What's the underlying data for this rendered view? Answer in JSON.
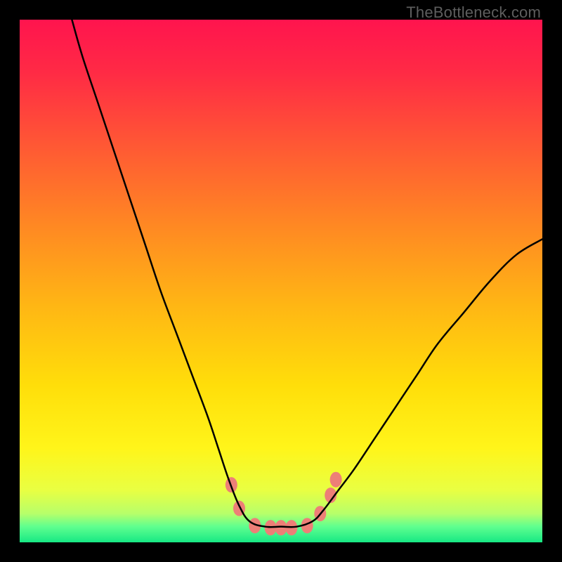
{
  "watermark": "TheBottleneck.com",
  "chart_data": {
    "type": "line",
    "title": "",
    "xlabel": "",
    "ylabel": "",
    "xlim": [
      0,
      100
    ],
    "ylim": [
      0,
      100
    ],
    "grid": false,
    "legend": false,
    "curve_main": {
      "description": "V-shaped black curve with flat bottom near y≈3 between x≈43 and x≈57; steep left arm reaching top-left, gentler right arm reaching ~y≈58 at right edge",
      "points": [
        {
          "x": 10,
          "y": 100
        },
        {
          "x": 12,
          "y": 93
        },
        {
          "x": 15,
          "y": 84
        },
        {
          "x": 18,
          "y": 75
        },
        {
          "x": 21,
          "y": 66
        },
        {
          "x": 24,
          "y": 57
        },
        {
          "x": 27,
          "y": 48
        },
        {
          "x": 30,
          "y": 40
        },
        {
          "x": 33,
          "y": 32
        },
        {
          "x": 36,
          "y": 24
        },
        {
          "x": 38,
          "y": 18
        },
        {
          "x": 40,
          "y": 12
        },
        {
          "x": 42,
          "y": 7
        },
        {
          "x": 44,
          "y": 4
        },
        {
          "x": 47,
          "y": 3
        },
        {
          "x": 50,
          "y": 3
        },
        {
          "x": 53,
          "y": 3
        },
        {
          "x": 56,
          "y": 4
        },
        {
          "x": 58,
          "y": 6
        },
        {
          "x": 61,
          "y": 10
        },
        {
          "x": 64,
          "y": 14
        },
        {
          "x": 68,
          "y": 20
        },
        {
          "x": 72,
          "y": 26
        },
        {
          "x": 76,
          "y": 32
        },
        {
          "x": 80,
          "y": 38
        },
        {
          "x": 85,
          "y": 44
        },
        {
          "x": 90,
          "y": 50
        },
        {
          "x": 95,
          "y": 55
        },
        {
          "x": 100,
          "y": 58
        }
      ]
    },
    "markers": {
      "description": "salmon/coral blob markers along the trough of the curve",
      "color": "#ed7f77",
      "points": [
        {
          "x": 40.5,
          "y": 11
        },
        {
          "x": 42,
          "y": 6.5
        },
        {
          "x": 45,
          "y": 3.2
        },
        {
          "x": 48,
          "y": 2.8
        },
        {
          "x": 50,
          "y": 2.8
        },
        {
          "x": 52,
          "y": 2.8
        },
        {
          "x": 55,
          "y": 3.2
        },
        {
          "x": 57.5,
          "y": 5.5
        },
        {
          "x": 59.5,
          "y": 9
        },
        {
          "x": 60.5,
          "y": 12
        }
      ]
    },
    "gradient": {
      "description": "vertical gradient from magenta-red at top through orange, yellow, to green band at very bottom",
      "stops": [
        {
          "offset": 0.0,
          "color": "#ff144e"
        },
        {
          "offset": 0.1,
          "color": "#ff2a45"
        },
        {
          "offset": 0.25,
          "color": "#ff5b33"
        },
        {
          "offset": 0.4,
          "color": "#ff8a22"
        },
        {
          "offset": 0.55,
          "color": "#ffb714"
        },
        {
          "offset": 0.7,
          "color": "#ffde0a"
        },
        {
          "offset": 0.82,
          "color": "#fff51a"
        },
        {
          "offset": 0.9,
          "color": "#e9ff42"
        },
        {
          "offset": 0.945,
          "color": "#b7ff6a"
        },
        {
          "offset": 0.97,
          "color": "#5fff8f"
        },
        {
          "offset": 1.0,
          "color": "#17e884"
        }
      ]
    }
  }
}
